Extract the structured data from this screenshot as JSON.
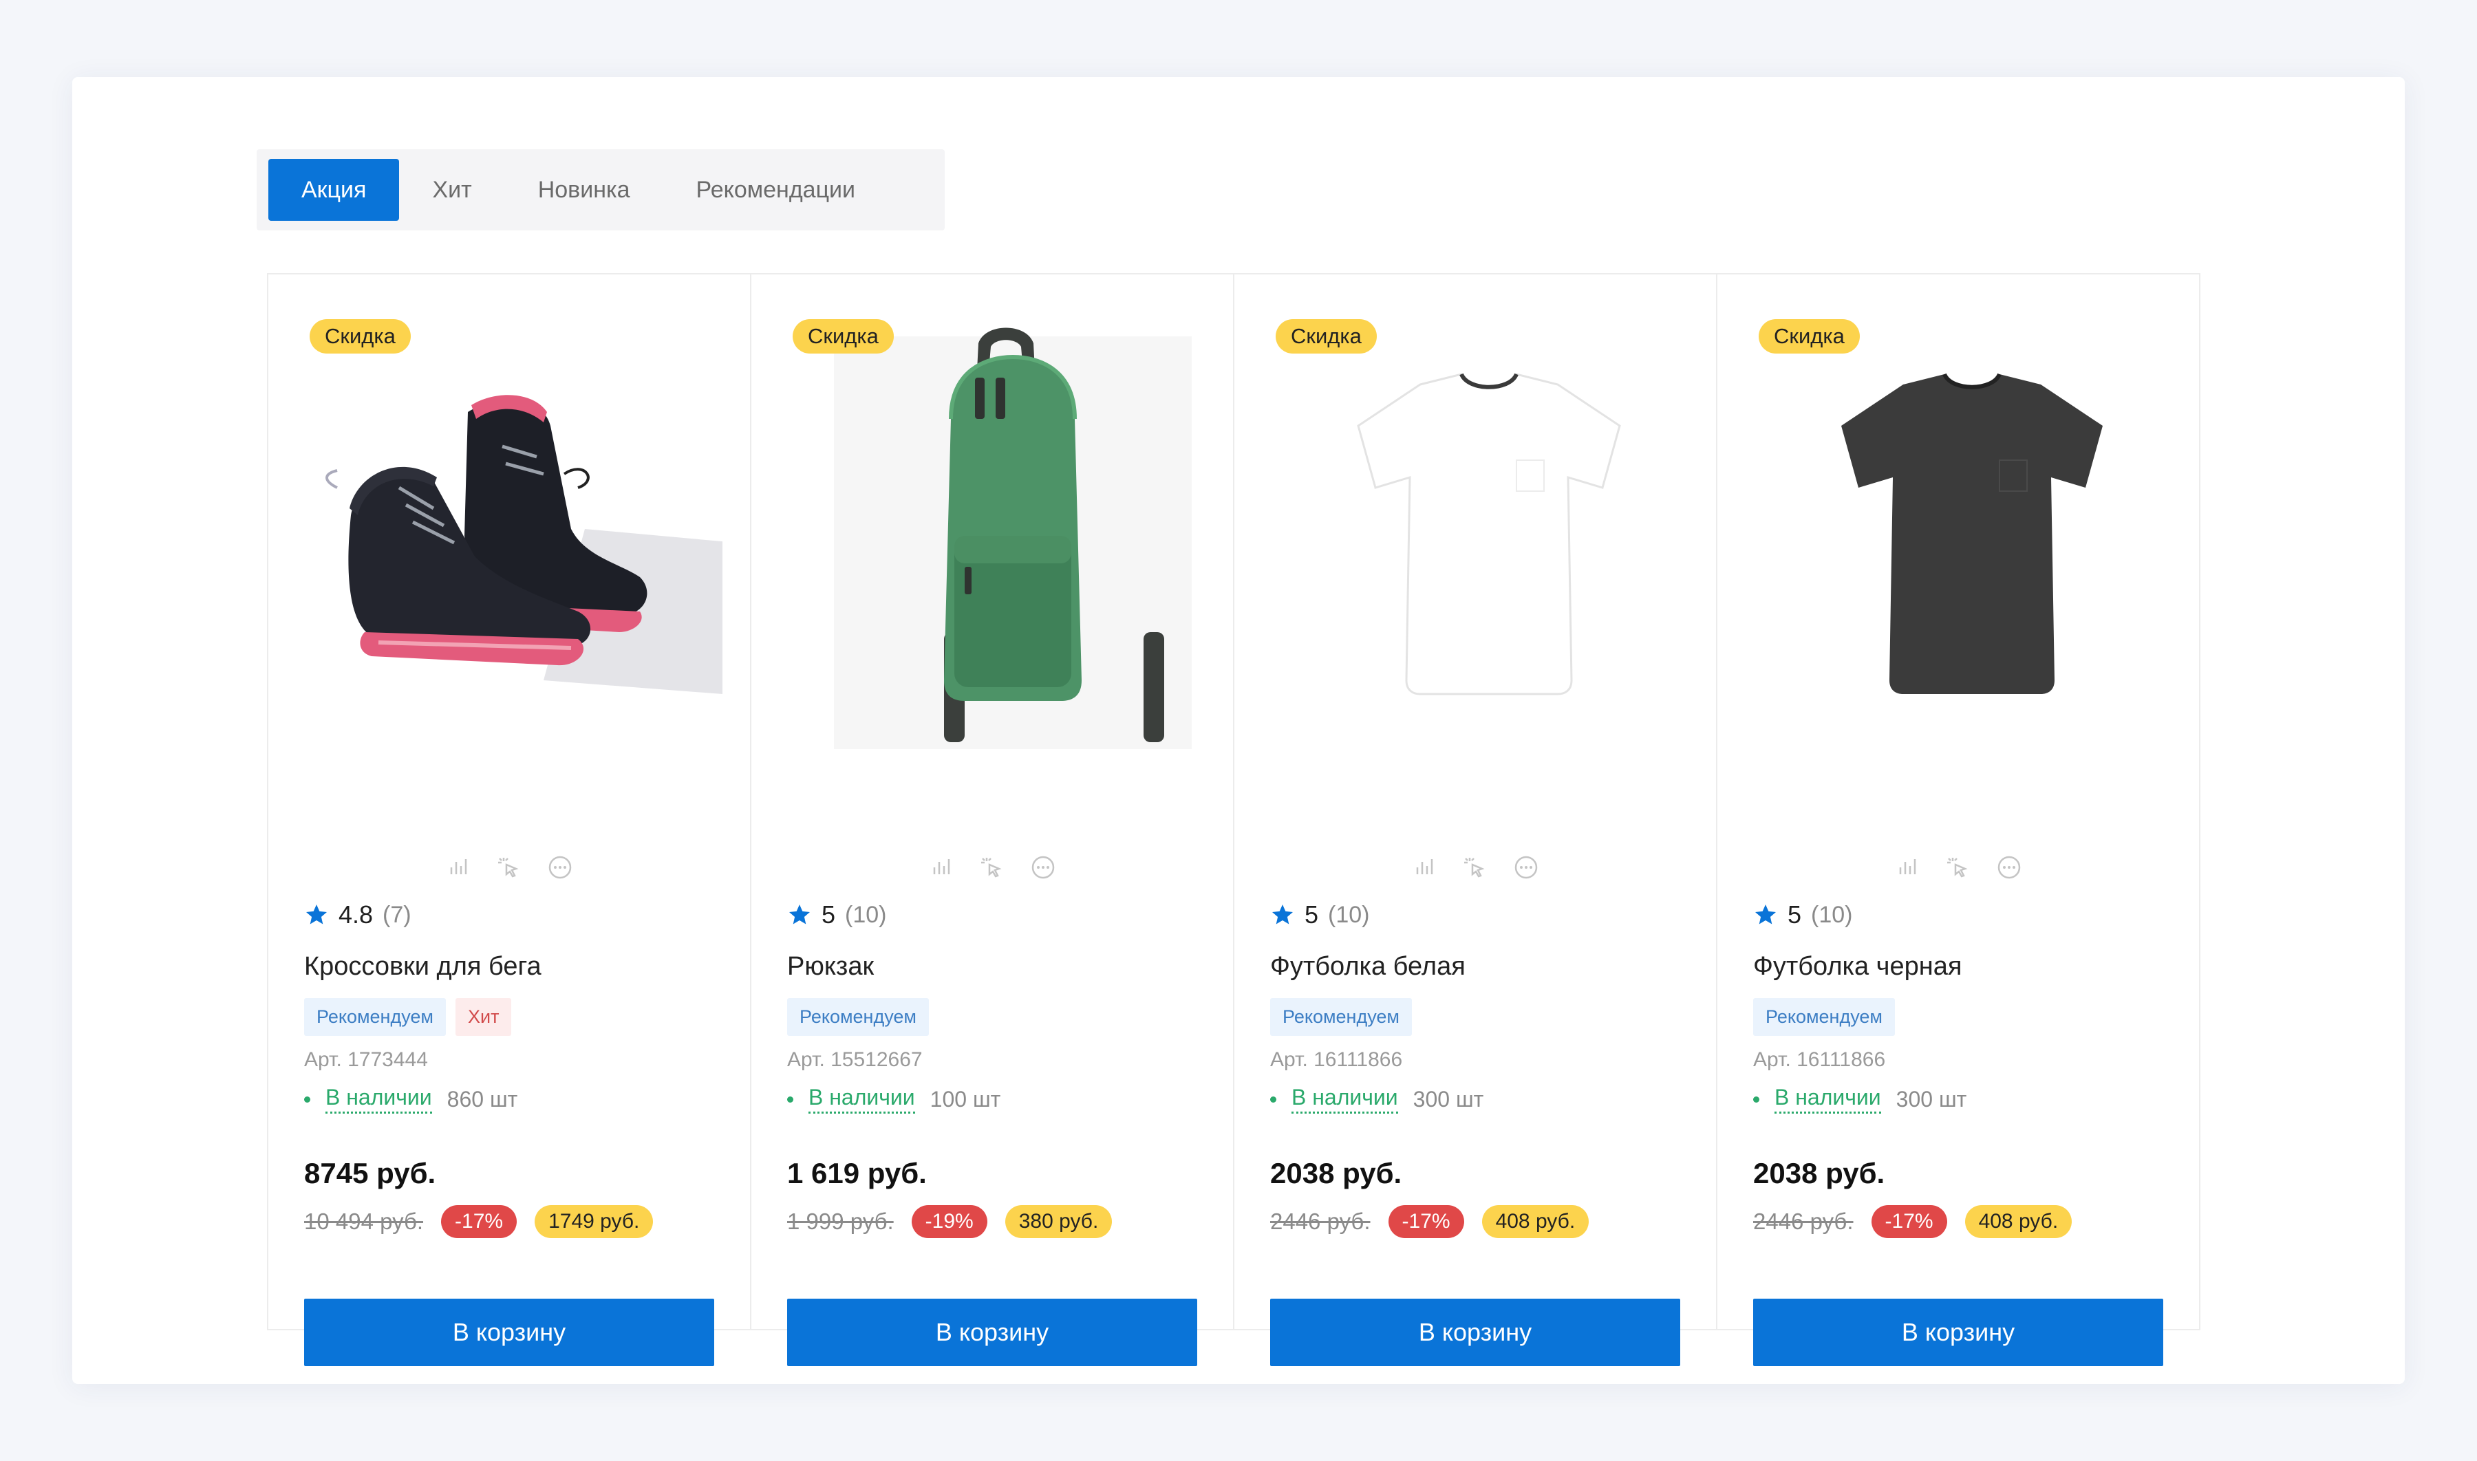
{
  "tabs": [
    {
      "label": "Акция",
      "active": true
    },
    {
      "label": "Хит",
      "active": false
    },
    {
      "label": "Новинка",
      "active": false
    },
    {
      "label": "Рекомендации",
      "active": false
    }
  ],
  "colors": {
    "accent": "#0a74d8",
    "sale_badge": "#fcd34d",
    "discount_badge": "#e04848",
    "in_stock": "#2aa96b",
    "recommend_bg": "#eaf3fd",
    "hit_bg": "#fdecec"
  },
  "products": [
    {
      "badge": "Скидка",
      "image": "sneakers-image",
      "rating": "4.8",
      "reviews": "(7)",
      "title": "Кроссовки для бега",
      "labels": [
        "Рекомендуем",
        "Хит"
      ],
      "sku": "Арт. 1773444",
      "availability": "В наличии",
      "quantity": "860 шт",
      "price": "8745 руб.",
      "old_price": "10 494 руб.",
      "discount": "-17%",
      "saving": "1749 руб.",
      "button": "В корзину"
    },
    {
      "badge": "Скидка",
      "image": "backpack-image",
      "rating": "5",
      "reviews": "(10)",
      "title": "Рюкзак",
      "labels": [
        "Рекомендуем"
      ],
      "sku": "Арт. 15512667",
      "availability": "В наличии",
      "quantity": "100 шт",
      "price": "1 619 руб.",
      "old_price": "1 999 руб.",
      "discount": "-19%",
      "saving": "380 руб.",
      "button": "В корзину"
    },
    {
      "badge": "Скидка",
      "image": "white-tshirt-image",
      "rating": "5",
      "reviews": "(10)",
      "title": "Футболка белая",
      "labels": [
        "Рекомендуем"
      ],
      "sku": "Арт. 16111866",
      "availability": "В наличии",
      "quantity": "300 шт",
      "price": "2038 руб.",
      "old_price": "2446 руб.",
      "discount": "-17%",
      "saving": "408 руб.",
      "button": "В корзину"
    },
    {
      "badge": "Скидка",
      "image": "black-tshirt-image",
      "rating": "5",
      "reviews": "(10)",
      "title": "Футболка черная",
      "labels": [
        "Рекомендуем"
      ],
      "sku": "Арт. 16111866",
      "availability": "В наличии",
      "quantity": "300 шт",
      "price": "2038 руб.",
      "old_price": "2446 руб.",
      "discount": "-17%",
      "saving": "408 руб.",
      "button": "В корзину"
    }
  ],
  "card_icons": [
    "compare-icon",
    "quick-view-icon",
    "more-icon"
  ]
}
